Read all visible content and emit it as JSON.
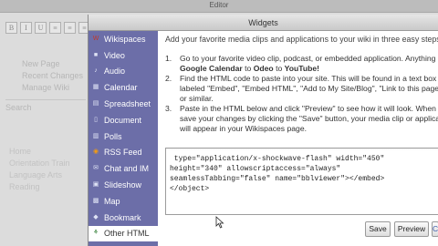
{
  "editor": {
    "title": "Editor",
    "toolbar": [
      "B",
      "I",
      "U",
      "≡",
      "≡",
      "≡",
      "≡"
    ],
    "sidebar": {
      "items": [
        "New Page",
        "Recent Changes",
        "Manage Wiki"
      ],
      "search": "Search",
      "lower": [
        "Home",
        "Orientation Train",
        "Language Arts",
        "Reading"
      ]
    }
  },
  "dialog": {
    "title": "Widgets",
    "nav": [
      {
        "label": "Wikispaces",
        "icon": "wikispaces-icon",
        "glyph": "W",
        "color": "#c0392b"
      },
      {
        "label": "Video",
        "icon": "video-icon",
        "glyph": "■",
        "color": "#dfe3f5"
      },
      {
        "label": "Audio",
        "icon": "audio-icon",
        "glyph": "♪",
        "color": "#dfe3f5"
      },
      {
        "label": "Calendar",
        "icon": "calendar-icon",
        "glyph": "▦",
        "color": "#dfe3f5"
      },
      {
        "label": "Spreadsheet",
        "icon": "spreadsheet-icon",
        "glyph": "▤",
        "color": "#dfe3f5"
      },
      {
        "label": "Document",
        "icon": "document-icon",
        "glyph": "▯",
        "color": "#dfe3f5"
      },
      {
        "label": "Polls",
        "icon": "polls-icon",
        "glyph": "▥",
        "color": "#dfe3f5"
      },
      {
        "label": "RSS Feed",
        "icon": "rss-icon",
        "glyph": "◉",
        "color": "#f39c12"
      },
      {
        "label": "Chat and IM",
        "icon": "chat-icon",
        "glyph": "✉",
        "color": "#dfe3f5"
      },
      {
        "label": "Slideshow",
        "icon": "slideshow-icon",
        "glyph": "▣",
        "color": "#dfe3f5"
      },
      {
        "label": "Map",
        "icon": "map-icon",
        "glyph": "▩",
        "color": "#dfe3f5"
      },
      {
        "label": "Bookmark",
        "icon": "bookmark-icon",
        "glyph": "◆",
        "color": "#dfe3f5"
      },
      {
        "label": "Other HTML",
        "icon": "other-html-icon",
        "glyph": "⚘",
        "color": "#2e7d32"
      }
    ],
    "active_nav": "Other HTML",
    "intro": "Add your favorite media clips and applications to your wiki in three easy steps:",
    "steps": [
      {
        "num": "1.",
        "lines": [
          "Go to your favorite video clip, podcast, or embedded application. Anything",
          "Google Calendar to Odeo to YouTube!"
        ]
      },
      {
        "num": "2.",
        "lines": [
          "Find the HTML code to paste into your site. This will be found in a text box",
          "labeled \"Embed\", \"Embed HTML\", \"Add to My Site/Blog\", \"Link to this page\"",
          "or similar."
        ]
      },
      {
        "num": "3.",
        "lines": [
          "Paste in the HTML below and click \"Preview\" to see how it will look. When",
          "save your changes by clicking the \"Save\" button, your media clip or applica",
          "will appear in your Wikispaces page."
        ]
      }
    ],
    "code": [
      " type=\"application/x-shockwave-flash\" width=\"450\"",
      "height=\"340\" allowscriptaccess=\"always\"",
      "seamlessTabbing=\"false\" name=\"bblviewer\"></embed>",
      "</object>"
    ],
    "buttons": {
      "save": "Save",
      "preview": "Preview",
      "cancel": "C"
    }
  }
}
